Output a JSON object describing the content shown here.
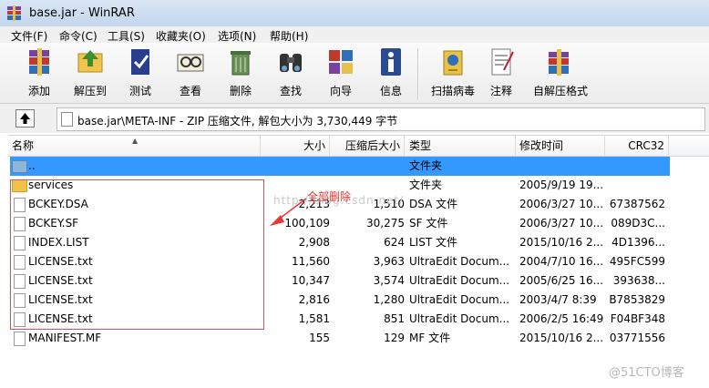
{
  "window": {
    "title": "base.jar - WinRAR"
  },
  "menu": [
    "文件(F)",
    "命令(C)",
    "工具(S)",
    "收藏夹(O)",
    "选项(N)",
    "帮助(H)"
  ],
  "toolbar": [
    "添加",
    "解压到",
    "测试",
    "查看",
    "删除",
    "查找",
    "向导",
    "信息",
    "扫描病毒",
    "注释",
    "自解压格式"
  ],
  "path": {
    "text": "base.jar\\META-INF - ZIP 压缩文件, 解包大小为 3,730,449 字节"
  },
  "columns": [
    "名称",
    "大小",
    "压缩后大小",
    "类型",
    "修改时间",
    "CRC32"
  ],
  "rows": [
    {
      "name": "..",
      "size": "",
      "packed": "",
      "type": "文件夹",
      "modified": "",
      "crc": "",
      "kind": "up",
      "selected": true
    },
    {
      "name": "services",
      "size": "",
      "packed": "",
      "type": "文件夹",
      "modified": "2005/9/19 19...",
      "crc": "",
      "kind": "folder"
    },
    {
      "name": "BCKEY.DSA",
      "size": "2,213",
      "packed": "1,510",
      "type": "DSA 文件",
      "modified": "2006/3/27 10...",
      "crc": "67387562",
      "kind": "file"
    },
    {
      "name": "BCKEY.SF",
      "size": "100,109",
      "packed": "30,275",
      "type": "SF 文件",
      "modified": "2006/3/27 10...",
      "crc": "089D3C...",
      "kind": "file"
    },
    {
      "name": "INDEX.LIST",
      "size": "2,908",
      "packed": "624",
      "type": "LIST 文件",
      "modified": "2015/10/16 2...",
      "crc": "4D1396...",
      "kind": "file"
    },
    {
      "name": "LICENSE.txt",
      "size": "11,560",
      "packed": "3,963",
      "type": "UltraEdit Docum...",
      "modified": "2004/7/10 16...",
      "crc": "495FC599",
      "kind": "file"
    },
    {
      "name": "LICENSE.txt",
      "size": "10,347",
      "packed": "3,574",
      "type": "UltraEdit Docum...",
      "modified": "2005/6/25 16...",
      "crc": "393638...",
      "kind": "file"
    },
    {
      "name": "LICENSE.txt",
      "size": "2,816",
      "packed": "1,280",
      "type": "UltraEdit Docum...",
      "modified": "2003/4/7 8:39",
      "crc": "B7853829",
      "kind": "file"
    },
    {
      "name": "LICENSE.txt",
      "size": "1,581",
      "packed": "851",
      "type": "UltraEdit Docum...",
      "modified": "2006/2/5 16:49",
      "crc": "F04BF348",
      "kind": "file"
    },
    {
      "name": "MANIFEST.MF",
      "size": "155",
      "packed": "129",
      "type": "MF 文件",
      "modified": "2015/10/16 2...",
      "crc": "03771556",
      "kind": "file"
    }
  ],
  "annotation": {
    "text": "全部删除",
    "color": "#e53935"
  },
  "watermarks": [
    "http://blog.csdn.net/",
    "@51CTO博客"
  ],
  "colors": {
    "selection": "#3399ff",
    "titlebar": "#c9dbef"
  }
}
